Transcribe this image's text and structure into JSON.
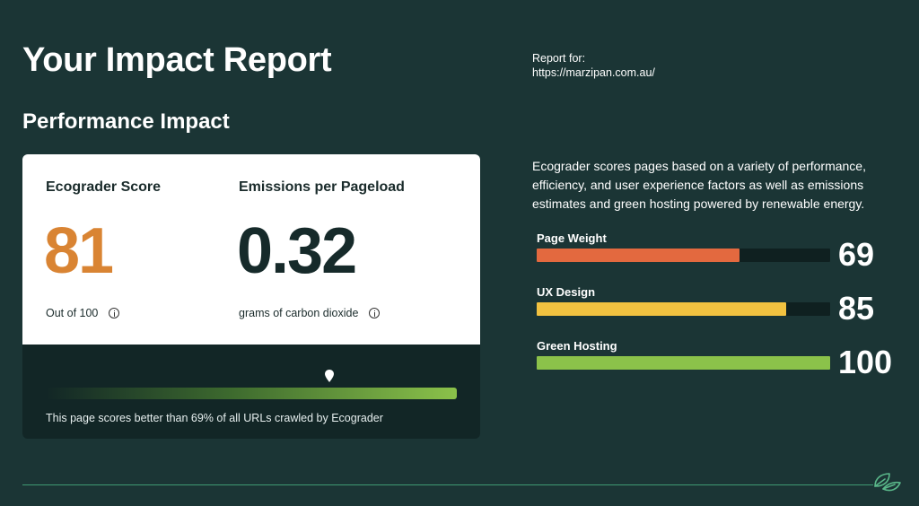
{
  "header": {
    "title": "Your Impact Report",
    "report_for_label": "Report for:",
    "report_url": "https://marzipan.com.au/"
  },
  "section": {
    "title": "Performance Impact"
  },
  "score_card": {
    "score": {
      "label": "Ecograder Score",
      "value": "81",
      "subtext": "Out of 100"
    },
    "emissions": {
      "label": "Emissions per Pageload",
      "value": "0.32",
      "subtext": "grams of carbon dioxide"
    },
    "percentile": 69,
    "caption": "This page scores better than 69% of all URLs crawled by Ecograder"
  },
  "description": "Ecograder scores pages based on a variety of performance, efficiency, and user experience factors as well as emissions estimates and green hosting powered by renewable energy.",
  "factors": [
    {
      "label": "Page Weight",
      "value": "69",
      "score": 69,
      "color": "#e3693f"
    },
    {
      "label": "UX Design",
      "value": "85",
      "score": 85,
      "color": "#f2c240"
    },
    {
      "label": "Green Hosting",
      "value": "100",
      "score": 100,
      "color": "#8bc24a"
    }
  ],
  "colors": {
    "background": "#1b3535",
    "score_accent": "#d98433",
    "divider": "#3f9a72"
  },
  "icons": {
    "info": "info-icon",
    "marker": "map-pin-icon",
    "logo": "leaf-logo-icon"
  }
}
